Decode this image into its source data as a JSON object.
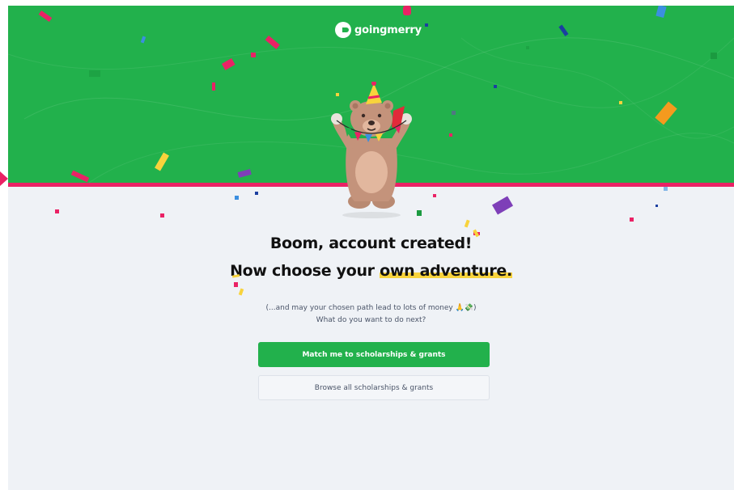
{
  "brand": {
    "name": "goingmerry",
    "green": "#22b14c",
    "pink": "#ea2265",
    "highlight": "#f8d33c"
  },
  "page": {
    "title_line1": "Boom, account created!",
    "title_line2_prefix": "Now choose your ",
    "title_line2_highlight": "own adventure.",
    "subtitle_line1": "(...and may your chosen path lead to lots of money 🙏💸)",
    "subtitle_line2": "What do you want to do next?"
  },
  "actions": {
    "primary_label": "Match me to scholarships & grants",
    "secondary_label": "Browse all scholarships & grants"
  },
  "icons": {
    "logo": "goingmerry-logo-icon",
    "mascot": "party-bear-illustration"
  }
}
